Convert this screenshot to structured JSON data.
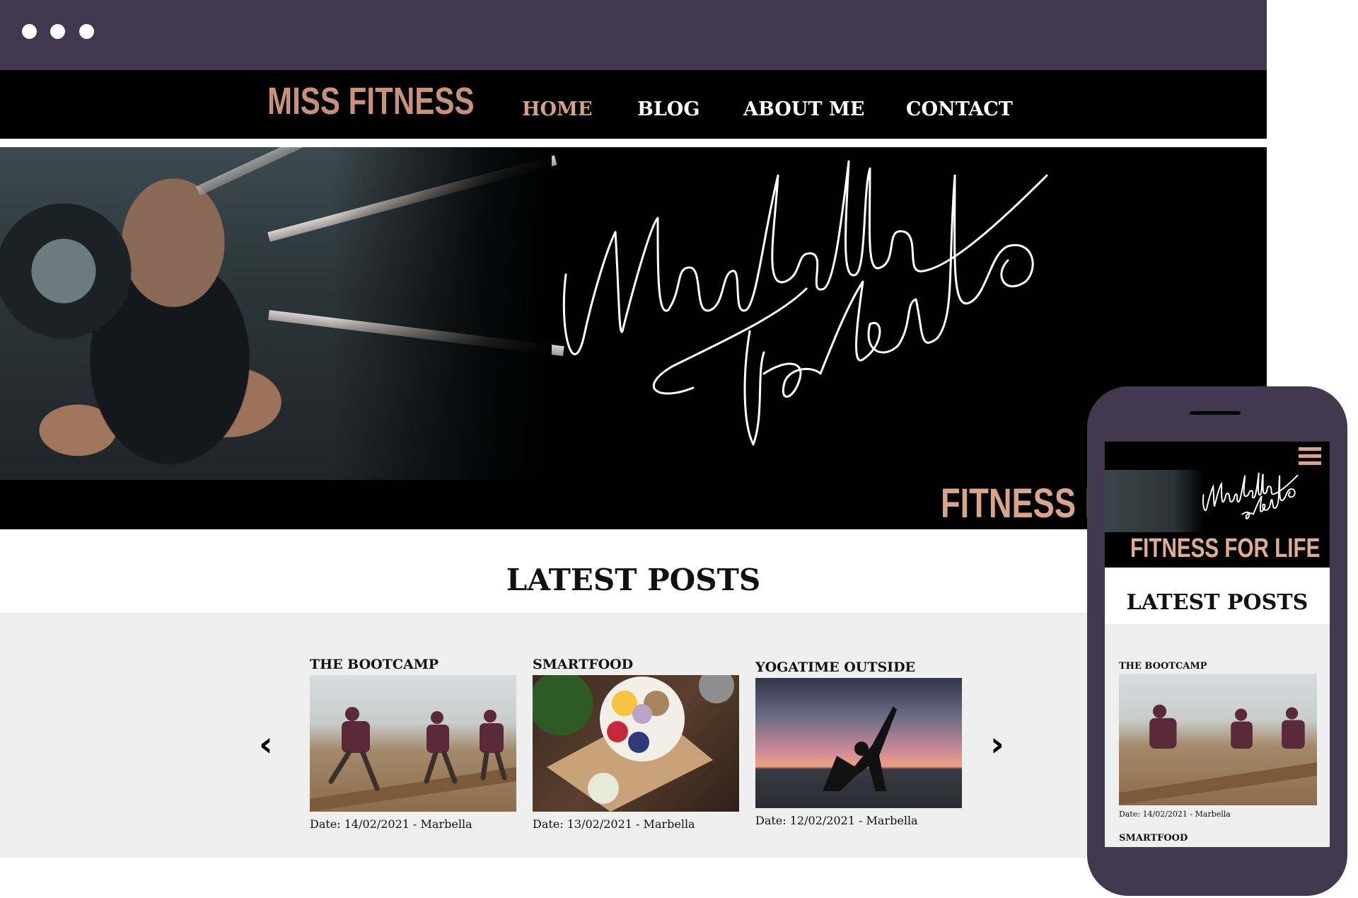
{
  "brand": {
    "logo": "MISS FITNESS"
  },
  "nav": [
    {
      "label": "HOME",
      "active": true
    },
    {
      "label": "BLOG",
      "active": false
    },
    {
      "label": "ABOUT ME",
      "active": false
    },
    {
      "label": "CONTACT",
      "active": false
    }
  ],
  "hero": {
    "signature": "Marbella Fabulo",
    "tagline_desktop": "FITNESS F",
    "tagline_mobile": "FITNESS FOR LIFE"
  },
  "latest": {
    "title": "LATEST POSTS"
  },
  "posts": [
    {
      "title": "THE BOOTCAMP",
      "meta": "Date: 14/02/2021 - Marbella",
      "image": "bootcamp-photo"
    },
    {
      "title": "SMARTFOOD",
      "meta": "Date: 13/02/2021 - Marbella",
      "image": "smartfood-photo"
    },
    {
      "title": "YOGATIME OUTSIDE",
      "meta": "Date: 12/02/2021 - Marbella",
      "image": "yoga-photo"
    }
  ],
  "mobile": {
    "latest_title": "LATEST POSTS",
    "posts": [
      {
        "title": "THE BOOTCAMP",
        "meta": "Date: 14/02/2021 - Marbella"
      },
      {
        "title": "SMARTFOOD"
      }
    ]
  },
  "icons": {
    "prev": "chevron-left-icon",
    "next": "chevron-right-icon",
    "menu": "hamburger-menu-icon"
  },
  "colors": {
    "titlebar": "#43394f",
    "nav_bg": "#000000",
    "accent": "#c8917a",
    "band_bg": "#efefef"
  }
}
